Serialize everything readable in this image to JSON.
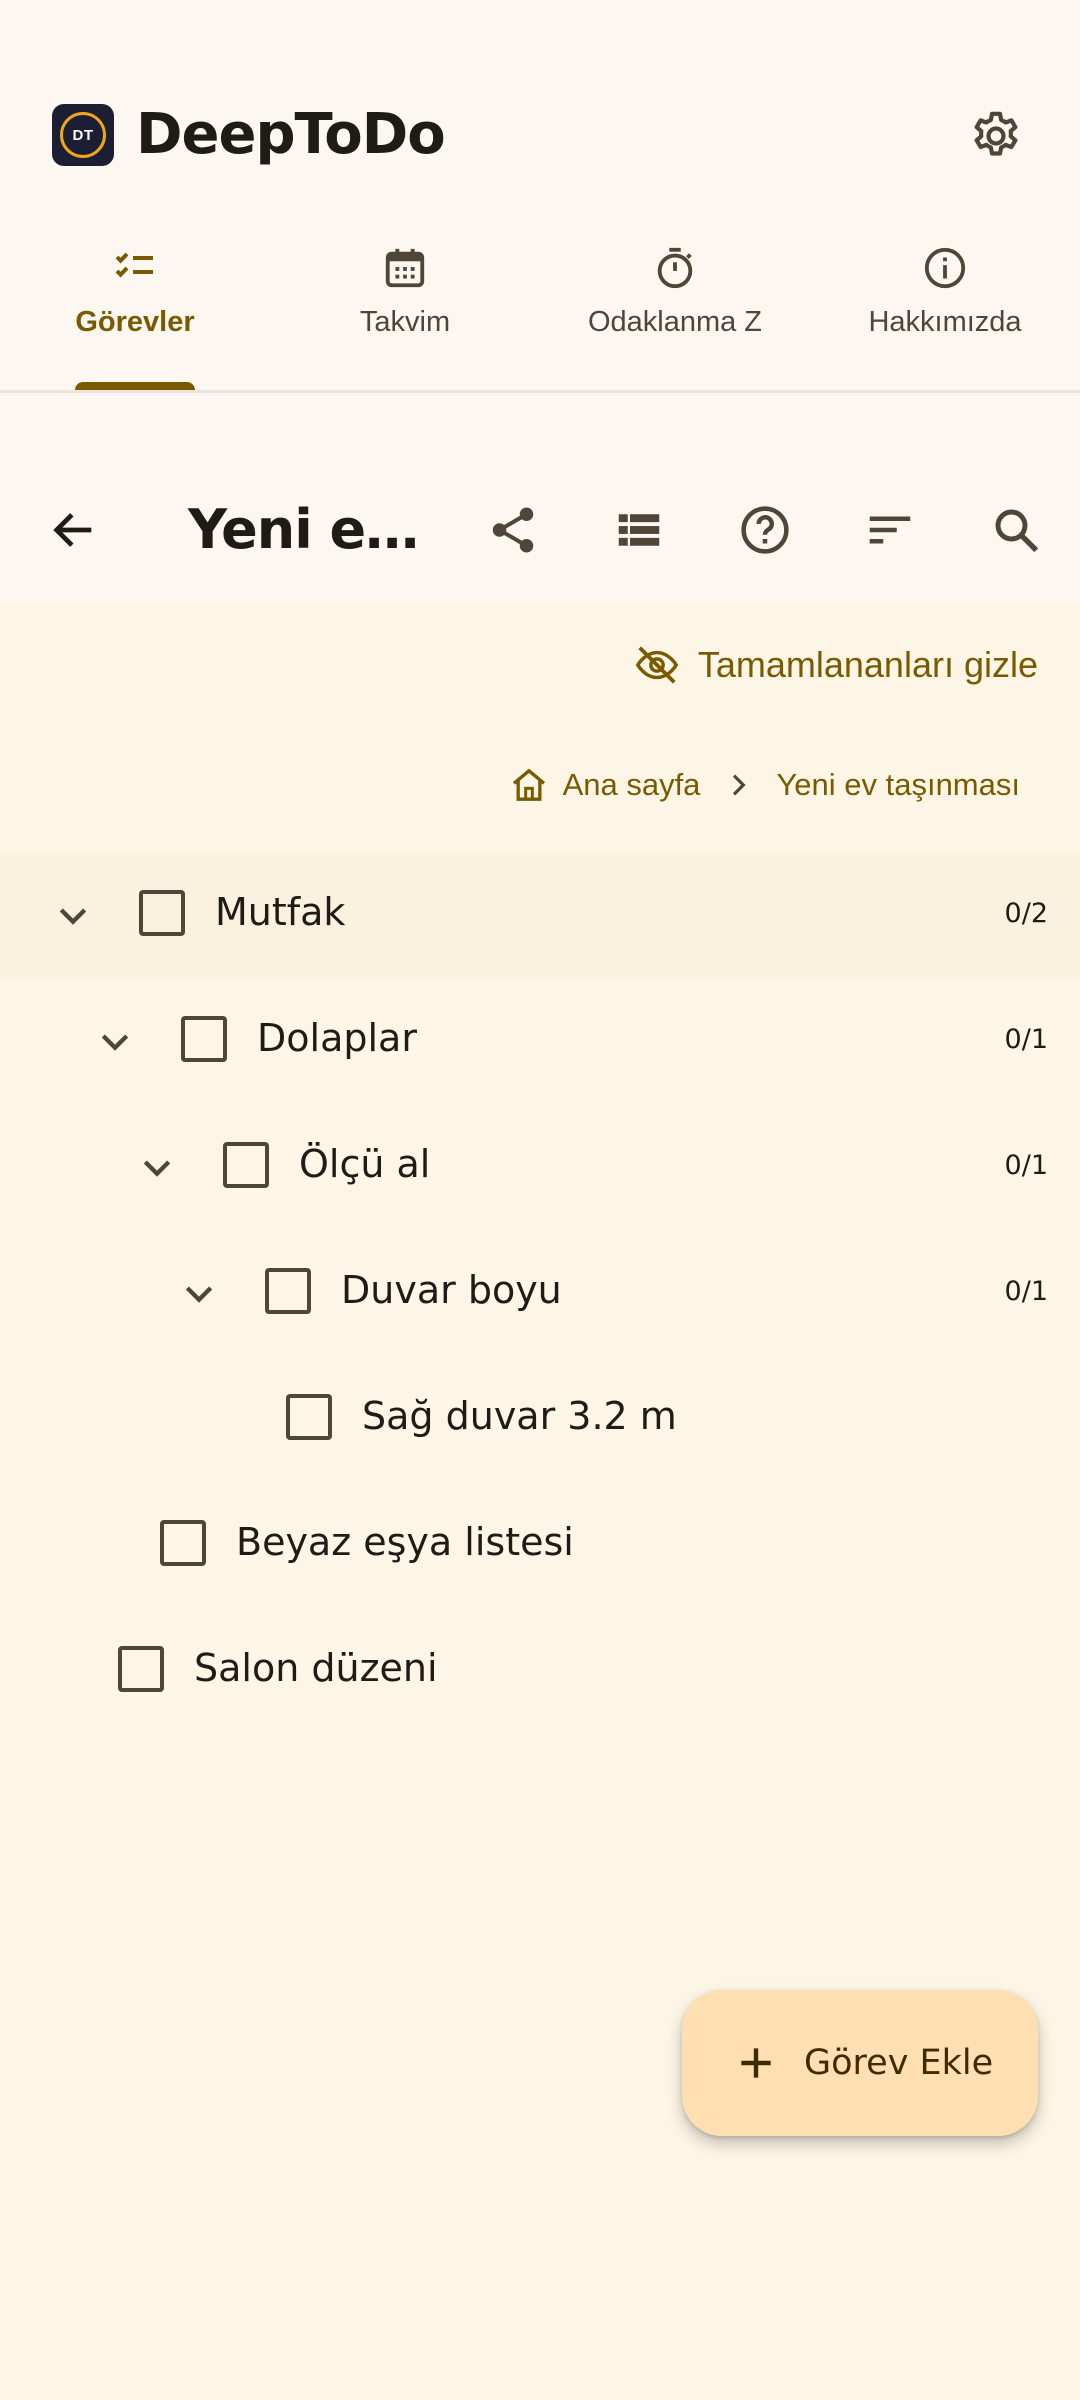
{
  "app": {
    "logo_text": "DT",
    "title": "DeepToDo",
    "settings_icon": "gear-icon"
  },
  "tabs": [
    {
      "label": "Görevler",
      "icon": "task-list-icon",
      "active": true
    },
    {
      "label": "Takvim",
      "icon": "calendar-icon",
      "active": false
    },
    {
      "label": "Odaklanma Z",
      "icon": "timer-icon",
      "active": false
    },
    {
      "label": "Hakkımızda",
      "icon": "info-icon",
      "active": false
    }
  ],
  "toolbar": {
    "title": "Yeni e…",
    "back_icon": "arrow-back-icon",
    "actions": [
      "share-icon",
      "list-view-icon",
      "help-icon",
      "sort-icon",
      "search-icon"
    ]
  },
  "filter": {
    "hide_completed_label": "Tamamlananları gizle",
    "icon": "eye-off-icon"
  },
  "breadcrumb": {
    "home_label": "Ana sayfa",
    "current_label": "Yeni ev taşınması"
  },
  "tasks": [
    {
      "label": "Mutfak",
      "count": "0/2",
      "expanded": true,
      "depth": 0,
      "checked": false
    },
    {
      "label": "Dolaplar",
      "count": "0/1",
      "expanded": true,
      "depth": 1,
      "checked": false
    },
    {
      "label": "Ölçü al",
      "count": "0/1",
      "expanded": true,
      "depth": 2,
      "checked": false
    },
    {
      "label": "Duvar boyu",
      "count": "0/1",
      "expanded": true,
      "depth": 3,
      "checked": false
    },
    {
      "label": "Sağ duvar 3.2 m",
      "count": "",
      "expanded": false,
      "depth": 4,
      "checked": false
    },
    {
      "label": "Beyaz eşya listesi",
      "count": "",
      "expanded": false,
      "depth": 1,
      "checked": false
    },
    {
      "label": "Salon düzeni",
      "count": "",
      "expanded": false,
      "depth": 0,
      "checked": false
    }
  ],
  "fab": {
    "label": "Görev Ekle",
    "icon": "plus-icon"
  },
  "colors": {
    "accent": "#7a5a00",
    "background": "#fdf6e6",
    "header_bg": "#fdf7f2",
    "fab_bg": "#fedfb2"
  }
}
